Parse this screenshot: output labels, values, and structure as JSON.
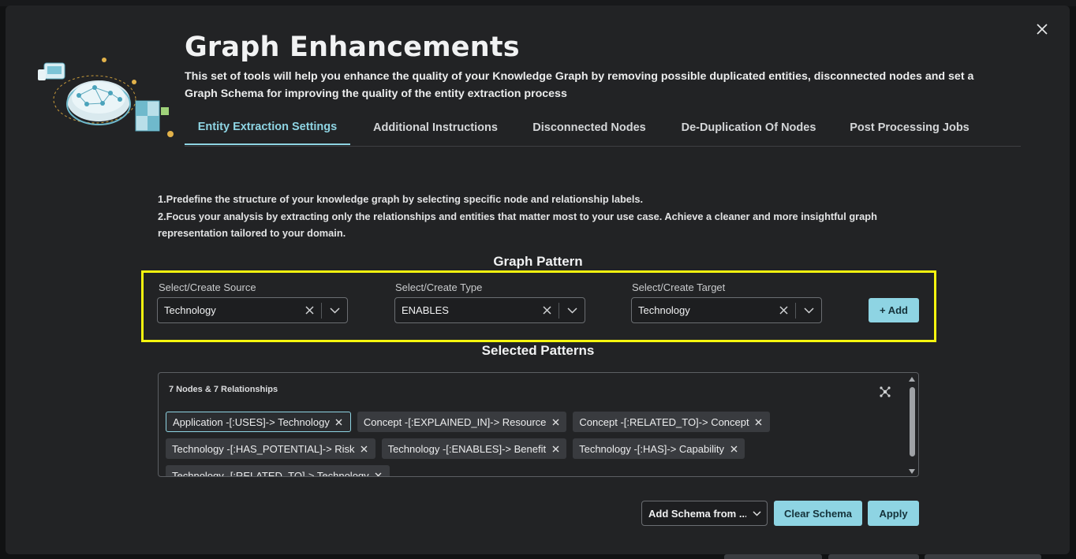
{
  "modal": {
    "title": "Graph Enhancements",
    "subtitle": "This set of tools will help you enhance the quality of your Knowledge Graph by removing possible duplicated entities, disconnected nodes and set a Graph Schema for improving the quality of the entity extraction process",
    "close_icon": "close-icon"
  },
  "tabs": [
    {
      "label": "Entity Extraction Settings",
      "active": true
    },
    {
      "label": "Additional Instructions",
      "active": false
    },
    {
      "label": "Disconnected Nodes",
      "active": false
    },
    {
      "label": "De-Duplication Of Nodes",
      "active": false
    },
    {
      "label": "Post Processing Jobs",
      "active": false
    }
  ],
  "description": {
    "line1": "1.Predefine the structure of your knowledge graph by selecting specific node and relationship labels.",
    "line2": "2.Focus your analysis by extracting only the relationships and entities that matter most to your use case. Achieve a cleaner and more insightful graph representation tailored to your domain."
  },
  "graph_pattern": {
    "heading": "Graph Pattern",
    "source": {
      "label": "Select/Create Source",
      "value": "Technology"
    },
    "type": {
      "label": "Select/Create Type",
      "value": "ENABLES"
    },
    "target": {
      "label": "Select/Create Target",
      "value": "Technology"
    },
    "add_label": "+ Add"
  },
  "selected_patterns": {
    "heading": "Selected Patterns",
    "count_text": "7 Nodes & 7 Relationships",
    "chips": [
      "Application -[:USES]-> Technology",
      "Concept -[:EXPLAINED_IN]-> Resource",
      "Concept -[:RELATED_TO]-> Concept",
      "Technology -[:HAS_POTENTIAL]-> Risk",
      "Technology -[:ENABLES]-> Benefit",
      "Technology -[:HAS]-> Capability",
      "Technology -[:RELATED_TO]-> Technology"
    ]
  },
  "footer": {
    "schema_dropdown": "Add Schema from ...",
    "clear_label": "Clear Schema",
    "apply_label": "Apply"
  },
  "colors": {
    "accent": "#8ed4e3",
    "highlight": "#f5f50f",
    "modal_bg": "#222325"
  }
}
